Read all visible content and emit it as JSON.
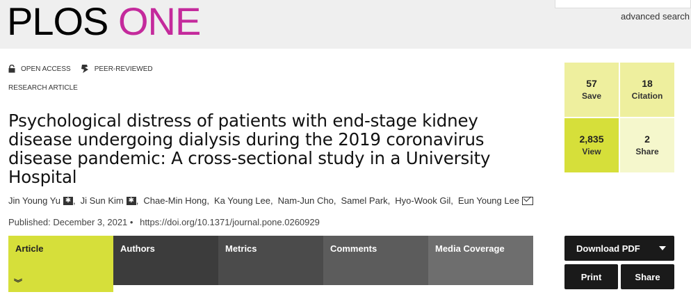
{
  "header": {
    "logo_part1": "PLOS",
    "logo_part2": "ONE",
    "advanced_search": "advanced search",
    "brand_color": "#c42a9c"
  },
  "badges": {
    "open_access": "OPEN ACCESS",
    "open_access_icon": "unlock-icon",
    "peer_reviewed": "PEER-REVIEWED",
    "peer_reviewed_icon": "peer-review-icon"
  },
  "article": {
    "type": "RESEARCH ARTICLE",
    "title": "Psychological distress of patients with end-stage kidney disease undergoing dialysis during the 2019 coronavirus disease pandemic: A cross-sectional study in a University Hospital",
    "authors": [
      {
        "name": "Jin Young Yu",
        "mark": "equal-contribution"
      },
      {
        "name": "Ji Sun Kim",
        "mark": "equal-contribution"
      },
      {
        "name": "Chae-Min Hong",
        "mark": ""
      },
      {
        "name": "Ka Young Lee",
        "mark": ""
      },
      {
        "name": "Nam-Jun Cho",
        "mark": ""
      },
      {
        "name": "Samel Park",
        "mark": ""
      },
      {
        "name": "Hyo-Wook Gil",
        "mark": ""
      },
      {
        "name": "Eun Young Lee",
        "mark": "corresponding"
      }
    ],
    "published": "Published: December 3, 2021",
    "doi": "https://doi.org/10.1371/journal.pone.0260929"
  },
  "tabs": [
    {
      "label": "Article",
      "active": true
    },
    {
      "label": "Authors",
      "active": false
    },
    {
      "label": "Metrics",
      "active": false
    },
    {
      "label": "Comments",
      "active": false
    },
    {
      "label": "Media Coverage",
      "active": false
    }
  ],
  "metrics": {
    "save": {
      "value": "57",
      "label": "Save"
    },
    "citation": {
      "value": "18",
      "label": "Citation"
    },
    "view": {
      "value": "2,835",
      "label": "View"
    },
    "share": {
      "value": "2",
      "label": "Share"
    }
  },
  "actions": {
    "download_pdf": "Download PDF",
    "print": "Print",
    "share": "Share"
  },
  "colors": {
    "accent": "#d6df3a",
    "dark_button": "#1a1a1a"
  }
}
